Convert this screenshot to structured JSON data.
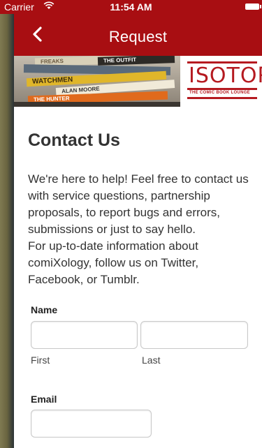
{
  "status_bar": {
    "carrier": "Carrier",
    "time": "11:54 AM"
  },
  "nav": {
    "title": "Request"
  },
  "banner": {
    "logo_text": "ISOTOPE",
    "logo_subtitle": "THE COMIC BOOK LOUNGE",
    "books": [
      "FREAKS",
      "THE OUTFIT",
      "WATCHMEN",
      "ALAN MOORE",
      "THE HUNTER"
    ]
  },
  "page": {
    "heading": "Contact Us",
    "intro_1": "We're here to help! Feel free to contact us with service questions, partnership proposals, to report bugs and errors, submissions or just to say hello.",
    "intro_2": "For up-to-date information about comiXology, follow us on Twitter, Facebook, or Tumblr."
  },
  "form": {
    "name_label": "Name",
    "first_label": "First",
    "last_label": "Last",
    "first_value": "",
    "last_value": "",
    "email_label": "Email",
    "email_value": ""
  },
  "colors": {
    "brand_red": "#a80e12",
    "logo_red": "#b51a20"
  }
}
